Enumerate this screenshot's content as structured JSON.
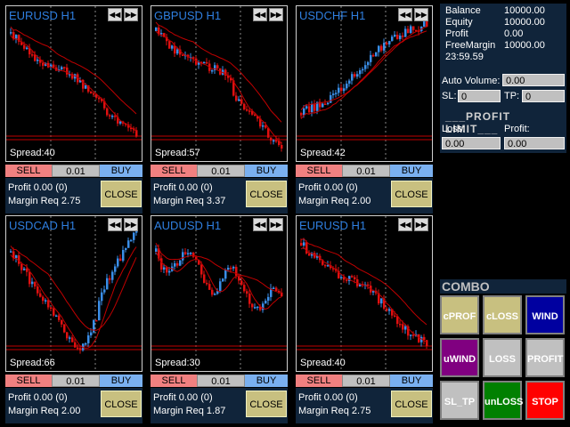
{
  "panels": [
    {
      "symbol": "EURUSD H1",
      "spread": "Spread:40",
      "sell": "SELL",
      "lot": "0.01",
      "buy": "BUY",
      "profit": "Profit 0.00 (0)",
      "margin": "Margin Req 2.75",
      "close": "CLOSE"
    },
    {
      "symbol": "GBPUSD H1",
      "spread": "Spread:57",
      "sell": "SELL",
      "lot": "0.01",
      "buy": "BUY",
      "profit": "Profit 0.00 (0)",
      "margin": "Margin Req 3.37",
      "close": "CLOSE"
    },
    {
      "symbol": "USDCHF H1",
      "spread": "Spread:42",
      "sell": "SELL",
      "lot": "0.01",
      "buy": "BUY",
      "profit": "Profit 0.00 (0)",
      "margin": "Margin Req 2.00",
      "close": "CLOSE"
    },
    {
      "symbol": "USDCAD H1",
      "spread": "Spread:66",
      "sell": "SELL",
      "lot": "0.01",
      "buy": "BUY",
      "profit": "Profit 0.00 (0)",
      "margin": "Margin Req 2.00",
      "close": "CLOSE"
    },
    {
      "symbol": "AUDUSD H1",
      "spread": "Spread:30",
      "sell": "SELL",
      "lot": "0.01",
      "buy": "BUY",
      "profit": "Profit 0.00 (0)",
      "margin": "Margin Req 1.87",
      "close": "CLOSE"
    },
    {
      "symbol": "EURUSD H1",
      "spread": "Spread:40",
      "sell": "SELL",
      "lot": "0.01",
      "buy": "BUY",
      "profit": "Profit 0.00 (0)",
      "margin": "Margin Req 2.75",
      "close": "CLOSE"
    }
  ],
  "nav_icons": [
    "rewind-icon",
    "fast-forward-icon"
  ],
  "account": {
    "balance_label": "Balance",
    "balance": "10000.00",
    "equity_label": "Equity",
    "equity": "10000.00",
    "profit_label": "Profit",
    "profit": "0.00",
    "freemargin_label": "FreeMargin",
    "freemargin": "10000.00",
    "time": "23:59.59"
  },
  "auto_volume": {
    "label": "Auto Volume:",
    "value": "0.00"
  },
  "sl": {
    "label": "SL:",
    "value": "0"
  },
  "tp": {
    "label": "TP:",
    "value": "0"
  },
  "profit_limit": {
    "title": "___PROFIT LIMIT___",
    "loss_label": "Loss:",
    "loss_value": "0.00",
    "profit_label": "Profit:",
    "profit_value": "0.00"
  },
  "combo": {
    "title": "COMBO",
    "buttons": [
      {
        "label": "cPROF",
        "bg": "#c8c080",
        "fg": "#ffffff"
      },
      {
        "label": "cLOSS",
        "bg": "#c8c080",
        "fg": "#ffffff"
      },
      {
        "label": "WIND",
        "bg": "#0000a0",
        "fg": "#ffffff"
      },
      {
        "label": "uWIND",
        "bg": "#800080",
        "fg": "#ffffff"
      },
      {
        "label": "LOSS",
        "bg": "#c0c0c0",
        "fg": "#ffffff"
      },
      {
        "label": "PROFIT",
        "bg": "#c0c0c0",
        "fg": "#ffffff"
      },
      {
        "label": "SL_TP",
        "bg": "#c0c0c0",
        "fg": "#ffffff"
      },
      {
        "label": "unLOSS",
        "bg": "#008000",
        "fg": "#ffffff"
      },
      {
        "label": "STOP",
        "bg": "#ff0000",
        "fg": "#ffffff"
      }
    ]
  },
  "colors": {
    "bull": "#3a8ee8",
    "bear": "#e01010",
    "ma": "#c00000",
    "panel_bg": "#10243a"
  }
}
